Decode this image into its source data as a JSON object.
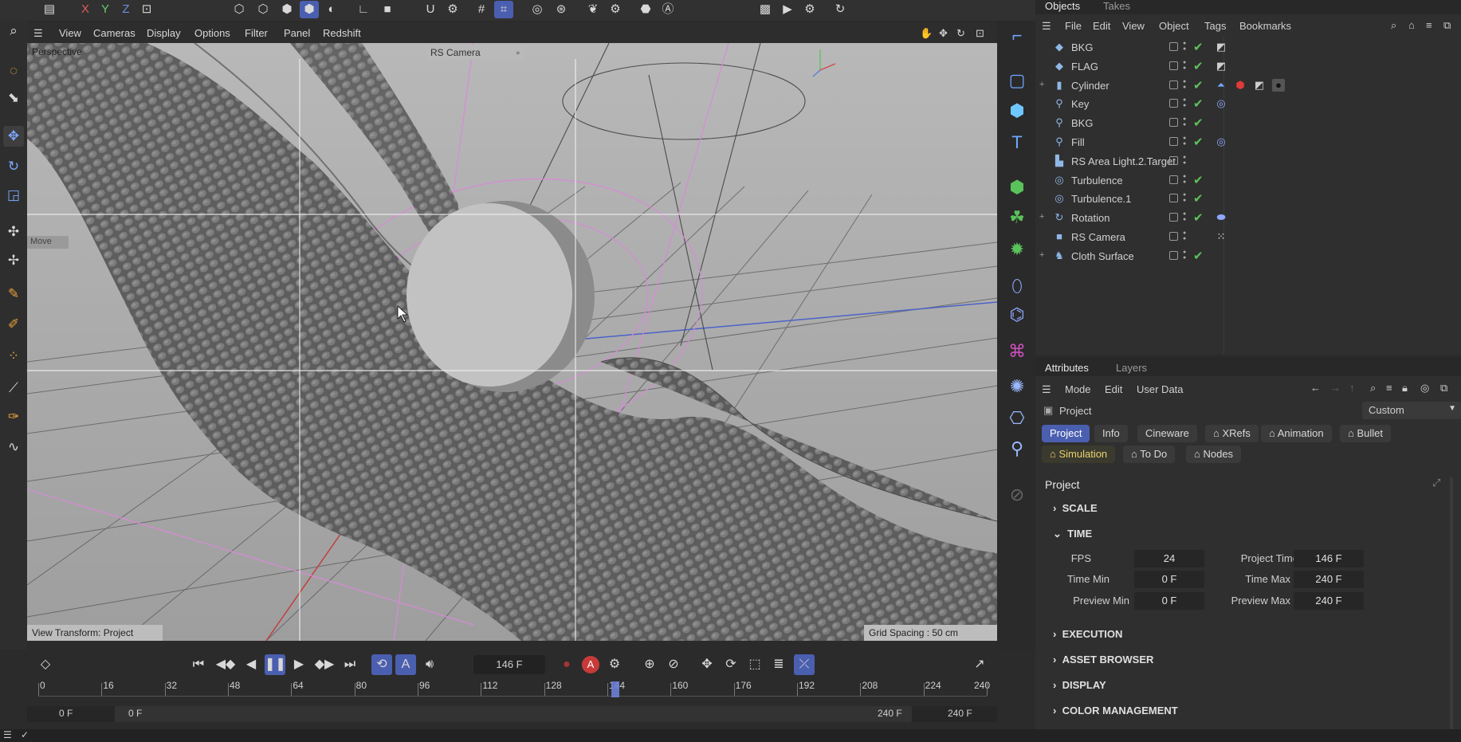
{
  "topbar": {
    "icons": [
      "film-icon",
      "x-axis-icon",
      "y-axis-icon",
      "z-axis-icon",
      "coordinate-icon",
      "point-mode-icon",
      "edge-mode-icon",
      "polygon-mode-icon",
      "object-mode-icon",
      "texture-mode-icon",
      "axis-mode-icon",
      "solo-icon",
      "magnet-icon",
      "snap-settings-icon",
      "grid-icon",
      "snap-grid-icon",
      "render-region-icon",
      "render-settings-icon",
      "butterfly-icon",
      "gear-icon",
      "render-picture-queue-icon",
      "redshift-icon",
      "clapper-icon",
      "render-view-icon",
      "render-settings-2-icon",
      "refresh-icon"
    ],
    "axis_labels": {
      "x": "X",
      "y": "Y",
      "z": "Z"
    }
  },
  "viewport": {
    "menu": [
      "View",
      "Cameras",
      "Display",
      "Options",
      "Filter",
      "Panel",
      "Redshift"
    ],
    "label": "Perspective",
    "camera": "RS Camera",
    "move_label": "Move",
    "view_transform": "View Transform: Project",
    "grid_spacing": "Grid Spacing : 50 cm",
    "colors": {
      "bg": "#a9a9a9",
      "guide": "#e8e8e8",
      "pink": "#d88ad8",
      "cloth": "#5e5e5e"
    }
  },
  "objects": {
    "tabs": [
      "Objects",
      "Takes"
    ],
    "menu": [
      "File",
      "Edit",
      "View",
      "Object",
      "Tags",
      "Bookmarks"
    ],
    "rows": [
      {
        "name": "BKG",
        "icon": "◆",
        "expand": "",
        "check": "✔",
        "tags": [
          "flag-tag"
        ]
      },
      {
        "name": "FLAG",
        "icon": "◆",
        "expand": "",
        "check": "✔",
        "tags": [
          "flag-tag"
        ]
      },
      {
        "name": "Cylinder",
        "icon": "▮",
        "expand": "+",
        "check": "✔",
        "tags": [
          "cloth-tag",
          "material-red-tag",
          "flag-tag",
          "material-black-tag"
        ]
      },
      {
        "name": "Key",
        "icon": "⚲",
        "expand": "",
        "check": "✔",
        "tags": [
          "target-tag"
        ]
      },
      {
        "name": "BKG",
        "icon": "⚲",
        "expand": "",
        "check": "✔",
        "tags": []
      },
      {
        "name": "Fill",
        "icon": "⚲",
        "expand": "",
        "check": "✔",
        "tags": [
          "target-tag"
        ]
      },
      {
        "name": "RS Area Light.2.Target",
        "icon": "▙",
        "expand": "",
        "check": "",
        "tags": []
      },
      {
        "name": "Turbulence",
        "icon": "◎",
        "expand": "",
        "check": "✔",
        "tags": []
      },
      {
        "name": "Turbulence.1",
        "icon": "◎",
        "expand": "",
        "check": "✔",
        "tags": []
      },
      {
        "name": "Rotation",
        "icon": "↻",
        "expand": "+",
        "check": "✔",
        "tags": [
          "rotation-tag"
        ]
      },
      {
        "name": "RS Camera",
        "icon": "■",
        "expand": "",
        "check": "",
        "tags": [
          "camera-tag"
        ]
      },
      {
        "name": "Cloth Surface",
        "icon": "♞",
        "expand": "+",
        "check": "✔",
        "tags": []
      }
    ]
  },
  "attributes": {
    "tabs": [
      "Attributes",
      "Layers"
    ],
    "menu": [
      "Mode",
      "Edit",
      "User Data"
    ],
    "object_label": "Project",
    "preset": "Custom",
    "chips_row1": [
      "Project",
      "Info",
      "Cineware",
      "XRefs",
      "Animation",
      "Bullet"
    ],
    "chips_row2": [
      "Simulation",
      "To Do",
      "Nodes"
    ],
    "section_title": "Project",
    "groups": {
      "scale": "SCALE",
      "time": "TIME",
      "execution": "EXECUTION",
      "asset": "ASSET BROWSER",
      "display": "DISPLAY",
      "color": "COLOR MANAGEMENT"
    },
    "time": {
      "fps_label": "FPS",
      "fps": "24",
      "project_time_label": "Project Time",
      "project_time": "146 F",
      "time_min_label": "Time Min",
      "time_min": "0 F",
      "time_max_label": "Time Max",
      "time_max": "240 F",
      "preview_min_label": "Preview Min",
      "preview_min": "0 F",
      "preview_max_label": "Preview Max",
      "preview_max": "240 F"
    }
  },
  "timeline": {
    "current_frame": "146 F",
    "ticks": [
      "0",
      "16",
      "32",
      "48",
      "64",
      "80",
      "96",
      "112",
      "128",
      "144",
      "160",
      "176",
      "192",
      "208",
      "224",
      "240"
    ],
    "start": "0 F",
    "preview_start": "0 F",
    "preview_end": "240 F",
    "end": "240 F",
    "playhead_frame": 146,
    "max_frame": 240
  },
  "accent": "#4b5fb0"
}
